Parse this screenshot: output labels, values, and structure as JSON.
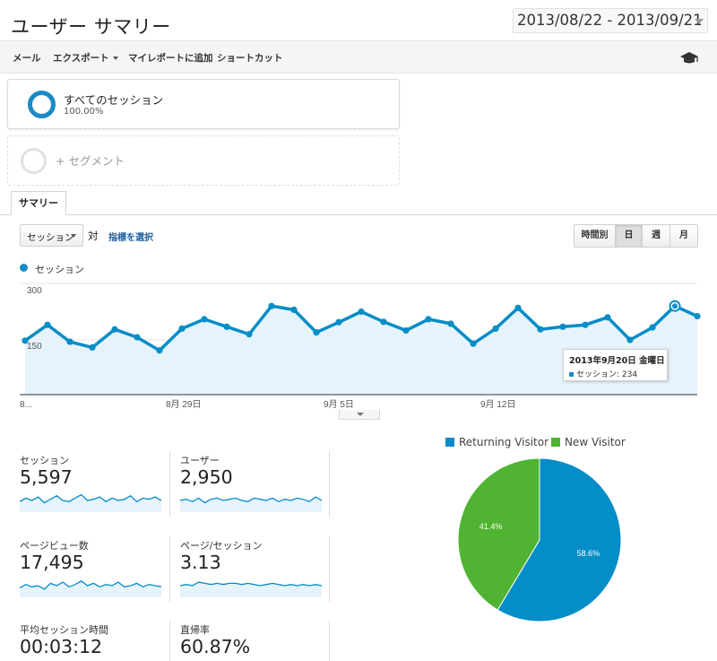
{
  "header": {
    "title": "ユーザー サマリー",
    "date_range": "2013/08/22 - 2013/09/21"
  },
  "toolbar": {
    "email": "メール",
    "export": "エクスポート",
    "add_dashboard": "マイレポートに追加",
    "shortcut": "ショートカット",
    "help_icon": "graduation-cap-icon"
  },
  "segments": {
    "active": {
      "name": "すべてのセッション",
      "percent": "100.00%"
    },
    "add_label": "+ セグメント"
  },
  "tabs": {
    "summary": "サマリー"
  },
  "chart_controls": {
    "metric": "セッション",
    "vs": "対",
    "select_metric": "指標を選択",
    "periods": [
      {
        "label": "時間別",
        "active": false
      },
      {
        "label": "日",
        "active": true
      },
      {
        "label": "週",
        "active": false
      },
      {
        "label": "月",
        "active": false
      }
    ]
  },
  "colors": {
    "accent": "#058dc7",
    "area": "#e7f3fa",
    "returning": "#058dc7",
    "new": "#50b432"
  },
  "chart_data": [
    {
      "type": "area",
      "title": "",
      "series": [
        {
          "name": "セッション",
          "values": [
            148,
            190,
            145,
            130,
            178,
            157,
            122,
            180,
            205,
            185,
            165,
            240,
            230,
            170,
            197,
            225,
            198,
            175,
            205,
            193,
            140,
            180,
            235,
            178,
            185,
            190,
            210,
            150,
            183,
            240,
            213
          ]
        }
      ],
      "y_ticks": [
        "300",
        "150"
      ],
      "ylim": [
        0,
        300
      ],
      "x_tick_labels": [
        "8...",
        "8月 29日",
        "9月 5日",
        "9月 12日"
      ],
      "highlight": {
        "date": "2013年9月20日 金曜日",
        "label": "セッション: 234"
      }
    },
    {
      "type": "pie",
      "labels": [
        "Returning Visitor",
        "New Visitor"
      ],
      "values": [
        58.6,
        41.4
      ],
      "value_labels": [
        "58.6%",
        "41.4%"
      ],
      "legend_position": "top"
    }
  ],
  "metrics": [
    {
      "label": "セッション",
      "value": "5,597",
      "spark": [
        0.45,
        0.6,
        0.5,
        0.65,
        0.4,
        0.55,
        0.7,
        0.5,
        0.45,
        0.6,
        0.75,
        0.5,
        0.55,
        0.65,
        0.45,
        0.6,
        0.5,
        0.55,
        0.7,
        0.45,
        0.6,
        0.55,
        0.65,
        0.5
      ]
    },
    {
      "label": "ユーザー",
      "value": "2,950",
      "spark": [
        0.5,
        0.55,
        0.45,
        0.6,
        0.4,
        0.55,
        0.6,
        0.5,
        0.55,
        0.6,
        0.5,
        0.45,
        0.6,
        0.55,
        0.5,
        0.6,
        0.45,
        0.55,
        0.5,
        0.6,
        0.55,
        0.45,
        0.65,
        0.5
      ]
    },
    {
      "label": "ページビュー数",
      "value": "17,495",
      "spark": [
        0.4,
        0.55,
        0.45,
        0.5,
        0.35,
        0.6,
        0.5,
        0.65,
        0.45,
        0.55,
        0.7,
        0.5,
        0.6,
        0.45,
        0.55,
        0.5,
        0.65,
        0.45,
        0.5,
        0.6,
        0.45,
        0.55,
        0.5,
        0.45
      ]
    },
    {
      "label": "ページ/セッション",
      "value": "3.13",
      "spark": [
        0.5,
        0.55,
        0.5,
        0.65,
        0.6,
        0.55,
        0.6,
        0.55,
        0.6,
        0.6,
        0.55,
        0.6,
        0.55,
        0.5,
        0.55,
        0.6,
        0.55,
        0.5,
        0.55,
        0.5,
        0.55,
        0.5,
        0.55,
        0.5
      ]
    },
    {
      "label": "平均セッション時間",
      "value": "00:03:12",
      "spark": []
    },
    {
      "label": "直帰率",
      "value": "60.87%",
      "spark": []
    }
  ]
}
